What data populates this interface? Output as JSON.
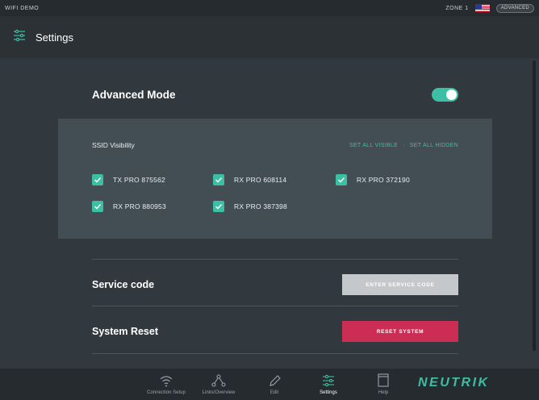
{
  "status_bar": {
    "network": "WIFI DEMO",
    "zone": "ZONE 1",
    "mode_badge": "ADVANCED"
  },
  "header": {
    "title": "Settings"
  },
  "advanced_mode": {
    "label": "Advanced Mode",
    "enabled": true
  },
  "ssid": {
    "label": "SSID Visibility",
    "set_all_visible": "SET ALL VISIBLE",
    "separator": "·",
    "set_all_hidden": "SET ALL HIDDEN",
    "devices": [
      {
        "name": "TX PRO 875562",
        "checked": true
      },
      {
        "name": "RX PRO 608114",
        "checked": true
      },
      {
        "name": "RX PRO 372190",
        "checked": true
      },
      {
        "name": "RX PRO 880953",
        "checked": true
      },
      {
        "name": "RX PRO 387398",
        "checked": true
      }
    ]
  },
  "service_code": {
    "label": "Service code",
    "button": "ENTER SERVICE CODE"
  },
  "system_reset": {
    "label": "System Reset",
    "button": "RESET SYSTEM"
  },
  "nav": {
    "items": [
      {
        "label": "Connection Setup",
        "icon": "wifi-icon",
        "active": false
      },
      {
        "label": "Links/Overview",
        "icon": "links-icon",
        "active": false
      },
      {
        "label": "Edit",
        "icon": "pencil-icon",
        "active": false
      },
      {
        "label": "Settings",
        "icon": "sliders-icon",
        "active": true
      },
      {
        "label": "Help",
        "icon": "help-icon",
        "active": false
      }
    ]
  },
  "brand": {
    "logo": "NEUTRIK"
  },
  "colors": {
    "accent": "#3cbfa4",
    "danger": "#cc2d55",
    "background": "#32393e",
    "panel": "#434d54"
  }
}
